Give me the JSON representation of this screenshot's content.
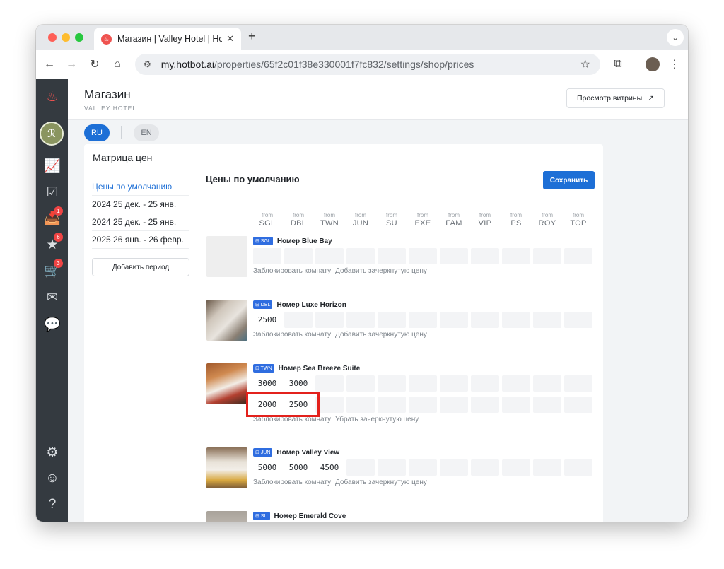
{
  "browser": {
    "tab_title": "Магазин | Valley Hotel | Hotbot",
    "url_host": "my.hotbot.ai",
    "url_path": "/properties/65f2c01f38e330001f7fc832/settings/shop/prices"
  },
  "sidebar": {
    "badges": {
      "inbox": "1",
      "reviews": "6",
      "cart": "3"
    }
  },
  "header": {
    "title": "Магазин",
    "subtitle": "VALLEY HOTEL",
    "showcase_button": "Просмотр витрины",
    "showcase_icon": "↗"
  },
  "languages": {
    "active": "RU",
    "inactive": "EN"
  },
  "card": {
    "title": "Матрица цен",
    "periods": [
      {
        "label": "Цены по умолчанию"
      },
      {
        "label": "2024 25 дек. - 25 янв."
      },
      {
        "label": "2024 25 дек. - 25 янв."
      },
      {
        "label": "2025 26 янв. - 26 февр."
      }
    ],
    "add_period": "Добавить период",
    "main_title": "Цены по умолчанию",
    "save_button": "Сохранить",
    "from_label": "from",
    "columns": [
      "SGL",
      "DBL",
      "TWN",
      "JUN",
      "SU",
      "EXE",
      "FAM",
      "VIP",
      "PS",
      "ROY",
      "TOP"
    ],
    "link_block": "Заблокировать комнату",
    "link_add_strike": "Добавить зачеркнутую цену",
    "link_remove_strike": "Убрать зачеркнутую цену",
    "rooms": [
      {
        "tag": "SGL",
        "name": "Номер Blue Bay",
        "prices": [],
        "strike": []
      },
      {
        "tag": "DBL",
        "name": "Номер Luxe Horizon",
        "prices": [
          "2500"
        ],
        "strike": []
      },
      {
        "tag": "TWN",
        "name": "Номер Sea Breeze Suite",
        "prices": [
          "3000",
          "3000"
        ],
        "strike": [
          "2000",
          "2500"
        ]
      },
      {
        "tag": "JUN",
        "name": "Номер Valley View",
        "prices": [
          "5000",
          "5000",
          "4500"
        ],
        "strike": []
      },
      {
        "tag": "SU",
        "name": "Номер Emerald Cove",
        "prices": [],
        "strike": []
      }
    ]
  },
  "colors": {
    "accent": "#1d6fd6",
    "rail": "#343a40",
    "highlight": "#e3211c"
  }
}
